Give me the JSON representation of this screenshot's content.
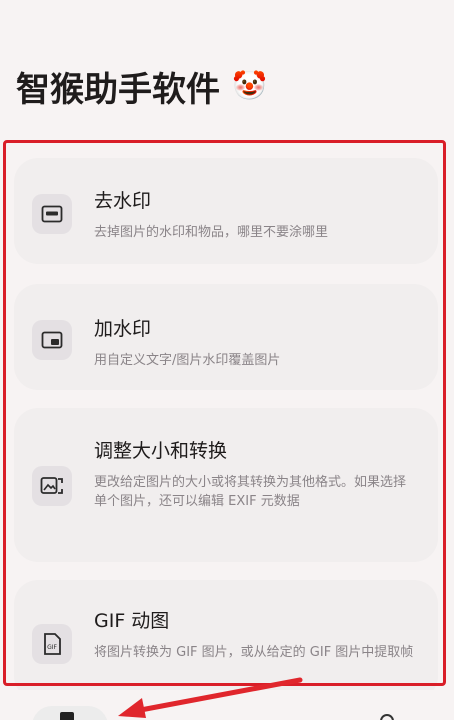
{
  "header": {
    "title": "智猴助手软件",
    "emoji": "🤡"
  },
  "cards": [
    {
      "icon": "remove-watermark-icon",
      "title": "去水印",
      "desc": "去掉图片的水印和物品，哪里不要涂哪里"
    },
    {
      "icon": "add-watermark-icon",
      "title": "加水印",
      "desc": "用自定义文字/图片水印覆盖图片"
    },
    {
      "icon": "resize-convert-icon",
      "title": "调整大小和转换",
      "desc": "更改给定图片的大小或将其转换为其他格式。如果选择单个图片，还可以编辑 EXIF 元数据"
    },
    {
      "icon": "gif-icon",
      "title": "GIF 动图",
      "desc": "将图片转换为 GIF 图片，或从给定的 GIF 图片中提取帧"
    }
  ],
  "colors": {
    "background": "#f7f3f3",
    "card": "#f1eeee",
    "highlight": "#d91e28",
    "annotation_arrow": "#e0262c"
  }
}
